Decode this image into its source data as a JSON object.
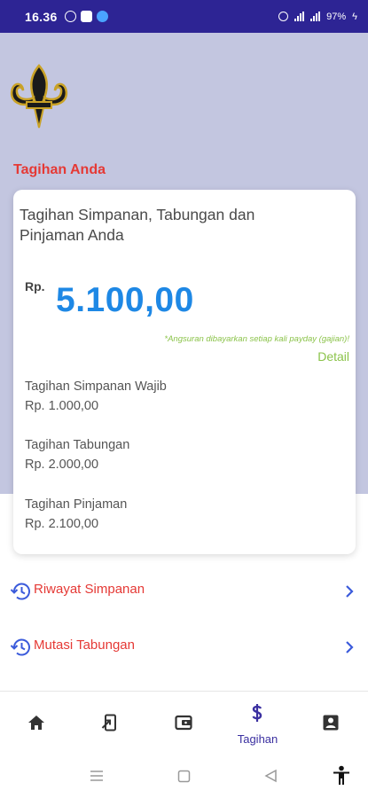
{
  "status_bar": {
    "time": "16.36",
    "battery": "97%"
  },
  "page": {
    "section_title": "Tagihan Anda"
  },
  "card": {
    "title": "Tagihan Simpanan, Tabungan dan Pinjaman Anda",
    "currency": "Rp.",
    "total": "5.100,00",
    "note": "*Angsuran dibayarkan setiap kali payday (gajian)!",
    "detail_label": "Detail",
    "items": [
      {
        "label": "Tagihan Simpanan Wajib",
        "value": "Rp. 1.000,00"
      },
      {
        "label": "Tagihan Tabungan",
        "value": "Rp. 2.000,00"
      },
      {
        "label": "Tagihan Pinjaman",
        "value": "Rp. 2.100,00"
      }
    ]
  },
  "menu": [
    {
      "label": "Riwayat Simpanan",
      "icon": "history-icon"
    },
    {
      "label": "Mutasi Tabungan",
      "icon": "history-icon"
    }
  ],
  "bottom_nav": {
    "active_label": "Tagihan",
    "items": [
      "home-icon",
      "transfer-icon",
      "wallet-icon",
      "dollar-icon",
      "profile-icon"
    ]
  },
  "colors": {
    "status_bar": "#2d2494",
    "accent_red": "#e53935",
    "amount_blue": "#1e88e5",
    "note_green": "#8bc34a",
    "nav_active": "#3a2fa0",
    "background_lavender": "#c3c6e0"
  }
}
